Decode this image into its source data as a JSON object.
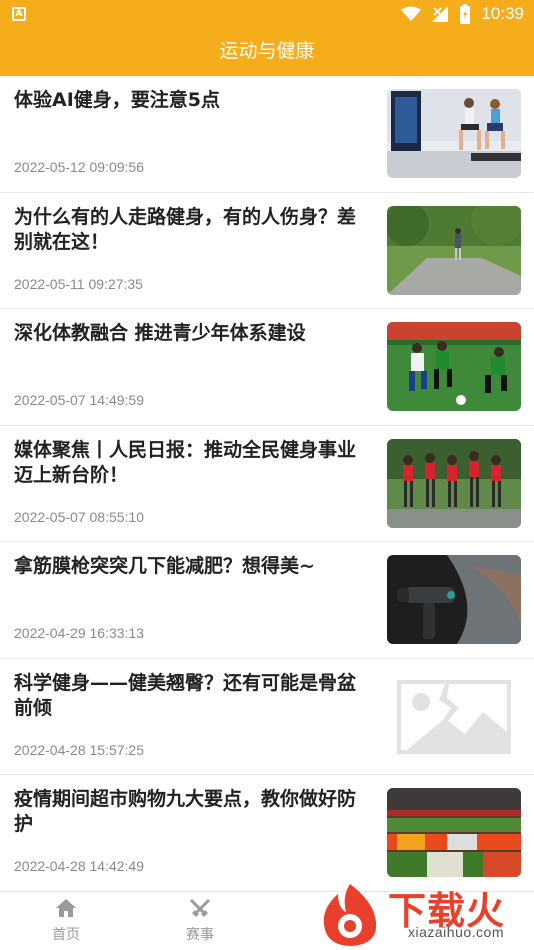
{
  "status": {
    "time": "10:39",
    "left_icon": "A"
  },
  "appbar": {
    "title": "运动与健康"
  },
  "articles": [
    {
      "title": "体验AI健身，要注意5点",
      "date": "2022-05-12 09:09:56",
      "image": "fitness-photo"
    },
    {
      "title": "为什么有的人走路健身，有的人伤身？差别就在这！",
      "date": "2022-05-11 09:27:35",
      "image": "walking-path-photo"
    },
    {
      "title": "深化体教融合 推进青少年体系建设",
      "date": "2022-05-07 14:49:59",
      "image": "soccer-photo"
    },
    {
      "title": "媒体聚焦丨人民日报：推动全民健身事业迈上新台阶！",
      "date": "2022-05-07 08:55:10",
      "image": "group-runners-photo"
    },
    {
      "title": "拿筋膜枪突突几下能减肥？想得美~",
      "date": "2022-04-29 16:33:13",
      "image": "massage-gun-photo"
    },
    {
      "title": "科学健身——健美翘臀？还有可能是骨盆前倾",
      "date": "2022-04-28 15:57:25",
      "image": "broken-image-placeholder"
    },
    {
      "title": "疫情期间超市购物九大要点，教你做好防护",
      "date": "2022-04-28 14:42:49",
      "image": "supermarket-produce-photo"
    }
  ],
  "tabs": [
    {
      "label": "首页",
      "icon": "home-icon"
    },
    {
      "label": "赛事",
      "icon": "crossed-swords-icon"
    }
  ],
  "watermark": {
    "brand": "下载火",
    "url": "xiazaihuo.com"
  },
  "colors": {
    "primary": "#f6ad1c",
    "brand_red": "#e8402a"
  }
}
